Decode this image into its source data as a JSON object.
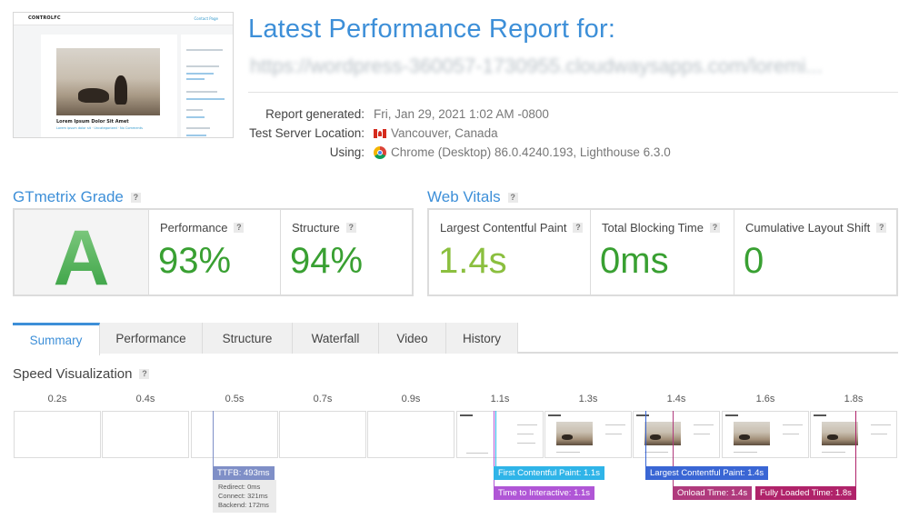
{
  "thumbnail": {
    "logo": "CONTROLFC",
    "nav_link": "Contact Page",
    "caption_title": "Lorem Ipsum Dolor Sit Amet",
    "caption_meta": "Lorem ipsum dolor sit · Uncategorized · No Comments"
  },
  "header": {
    "title": "Latest Performance Report for:",
    "url": "https://wordpress-360057-1730955.cloudwaysapps.com/loremi..."
  },
  "report_info": {
    "generated_label": "Report generated:",
    "generated_value": "Fri, Jan 29, 2021 1:02 AM -0800",
    "location_label": "Test Server Location:",
    "location_value": "Vancouver, Canada",
    "using_label": "Using:",
    "using_value": "Chrome (Desktop) 86.0.4240.193, Lighthouse 6.3.0"
  },
  "gtmetrix": {
    "heading": "GTmetrix Grade",
    "help": "?",
    "grade": "A",
    "performance_label": "Performance",
    "performance_value": "93%",
    "structure_label": "Structure",
    "structure_value": "94%"
  },
  "web_vitals": {
    "heading": "Web Vitals",
    "help": "?",
    "lcp_label": "Largest Contentful Paint",
    "lcp_value": "1.4s",
    "tbt_label": "Total Blocking Time",
    "tbt_value": "0ms",
    "cls_label": "Cumulative Layout Shift",
    "cls_value": "0"
  },
  "colors": {
    "accent": "#3d8fd8",
    "good_green": "#39a032",
    "lcp_green": "#8bbf3f",
    "ttfb": "#7f8fc7",
    "fcp": "#2fb4e8",
    "tti": "#b056d6",
    "lcp_event": "#3a66d4",
    "onload": "#b03a7d",
    "fully_loaded": "#b0236a"
  },
  "tabs": [
    "Summary",
    "Performance",
    "Structure",
    "Waterfall",
    "Video",
    "History"
  ],
  "speed_visualization": {
    "heading": "Speed Visualization",
    "help": "?",
    "times": [
      "0.2s",
      "0.4s",
      "0.5s",
      "0.7s",
      "0.9s",
      "1.1s",
      "1.3s",
      "1.4s",
      "1.6s",
      "1.8s"
    ],
    "events": {
      "ttfb": "TTFB: 493ms",
      "ttfb_redirect": "Redirect: 0ms",
      "ttfb_connect": "Connect: 321ms",
      "ttfb_backend": "Backend: 172ms",
      "fcp": "First Contentful Paint: 1.1s",
      "tti": "Time to Interactive: 1.1s",
      "lcp": "Largest Contentful Paint: 1.4s",
      "onload": "Onload Time: 1.4s",
      "fully_loaded": "Fully Loaded Time: 1.8s"
    }
  }
}
